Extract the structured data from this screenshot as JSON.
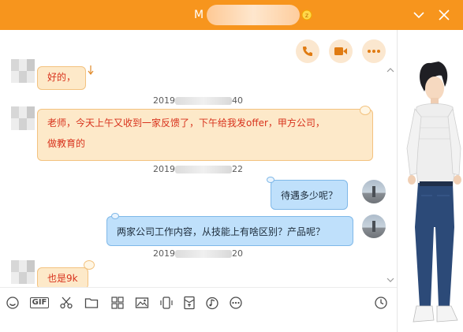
{
  "window": {
    "title_prefix": "M",
    "controls": {
      "minimize_icon": "chevron-down-icon",
      "close_icon": "close-icon"
    }
  },
  "call_actions": {
    "voice_icon": "phone-icon",
    "video_icon": "video-camera-icon",
    "more_icon": "more-horizontal-icon",
    "accent": "#e88a1a"
  },
  "messages": [
    {
      "side": "left",
      "text": "好的，"
    },
    {
      "side": "left",
      "timestamp_visible": "2019",
      "timestamp_tail": "40",
      "lines": [
        "老师，今天上午又收到一家反馈了，下午给我发offer，甲方公司，",
        "做教育的"
      ]
    },
    {
      "side": "right",
      "timestamp_visible": "2019",
      "timestamp_tail": "22",
      "text": "待遇多少呢？"
    },
    {
      "side": "right",
      "text": "两家公司工作内容，从技能上有啥区别？产品呢？"
    },
    {
      "side": "left",
      "timestamp_visible": "2019",
      "timestamp_tail": "20",
      "text": "也是9k"
    }
  ],
  "toolbar": {
    "items": [
      "smile-icon",
      "gif-icon",
      "scissors-icon",
      "folder-icon",
      "screenshot-icon",
      "image-icon",
      "shake-icon",
      "red-packet-icon",
      "music-icon",
      "more-circle-icon"
    ],
    "gif_label": "GIF",
    "history_icon": "clock-icon"
  },
  "colors": {
    "titlebar": "#f7951d",
    "left_bubble_bg": "#fde9c9",
    "left_bubble_text": "#d8321c",
    "right_bubble_bg": "#bfe0fb",
    "right_bubble_text": "#1c2b3a"
  }
}
